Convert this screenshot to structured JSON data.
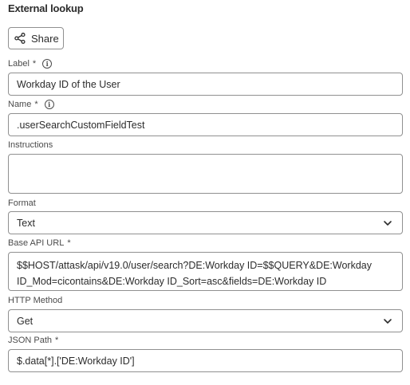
{
  "section": {
    "title": "External lookup"
  },
  "toolbar": {
    "share_label": "Share"
  },
  "fields": {
    "label": {
      "label": "Label",
      "required": "*",
      "value": "Workday ID of the User"
    },
    "name": {
      "label": "Name",
      "required": "*",
      "value": ".userSearchCustomFieldTest"
    },
    "instructions": {
      "label": "Instructions",
      "value": ""
    },
    "format": {
      "label": "Format",
      "value": "Text"
    },
    "base_api_url": {
      "label": "Base API URL",
      "required": "*",
      "value_line1": "$$HOST/attask/api/v19.0/user/search?DE:Workday ID=$$QUERY&DE:Workday",
      "value_line2": "ID_Mod=cicontains&DE:Workday ID_Sort=asc&fields=DE:Workday ID"
    },
    "http_method": {
      "label": "HTTP Method",
      "value": "Get"
    },
    "json_path": {
      "label": "JSON Path",
      "required": "*",
      "value": "$.data[*].['DE:Workday ID']"
    }
  },
  "icons": {
    "share": "share-icon",
    "info": "info-icon",
    "chevron": "chevron-down-icon"
  },
  "colors": {
    "border": "#909090",
    "text": "#2c2c2c",
    "label": "#4b4b4b"
  }
}
